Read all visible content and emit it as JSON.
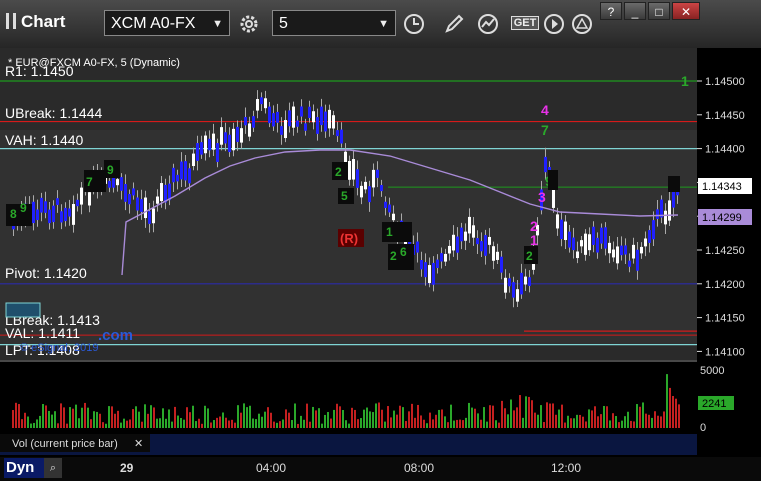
{
  "app": {
    "title": "Chart"
  },
  "toolbar": {
    "symbol": "XCM A0-FX",
    "interval": "5",
    "get_label": "GET"
  },
  "window_buttons": [
    "?",
    "_",
    "□",
    "✕"
  ],
  "chart": {
    "header": "* EUR@FXCM A0-FX, 5 (Dynamic)",
    "copyright": "© eSignal, 2019",
    "watermark": ".com",
    "price_axis": {
      "ticks": [
        "1.14500",
        "1.14450",
        "1.14400",
        "1.14350",
        "1.14300",
        "1.14250",
        "1.14200",
        "1.14150",
        "1.14100"
      ],
      "last_price": "1.14343",
      "vwap_price": "1.14299"
    },
    "levels": [
      {
        "label": "R1: 1.1450",
        "price": 1.145,
        "color": "#1e9a1e"
      },
      {
        "label": "UBreak: 1.1444",
        "price": 1.1444,
        "color": "#d41a1a"
      },
      {
        "label": "VAH: 1.1440",
        "price": 1.144,
        "color": "#7fd4d4"
      },
      {
        "label": "Pivot: 1.1420",
        "price": 1.142,
        "color": "#2a2aa8"
      },
      {
        "label": "LBreak: 1.1413",
        "price": 1.1413,
        "color": "#d41a1a"
      },
      {
        "label": "VAL: 1.1411",
        "price": 1.1411,
        "color": "#7fd4d4"
      },
      {
        "label": "LPT: 1.1408",
        "price": 1.1408,
        "color": "#bbb"
      }
    ],
    "annotations": {
      "magenta_4": "4",
      "green_7": "7",
      "label_R": "(R)",
      "green_9": "9",
      "magenta_3": "3",
      "magenta_2": "2",
      "magenta_1": "1",
      "green_1_right": "1"
    },
    "volume_panel": {
      "ticks": [
        "5000",
        "0"
      ],
      "current_volume": "2241",
      "legend": "Vol (current price bar)"
    },
    "time_axis": [
      "29",
      "04:00",
      "08:00",
      "12:00"
    ]
  },
  "bottom": {
    "label": "Dyn"
  }
}
